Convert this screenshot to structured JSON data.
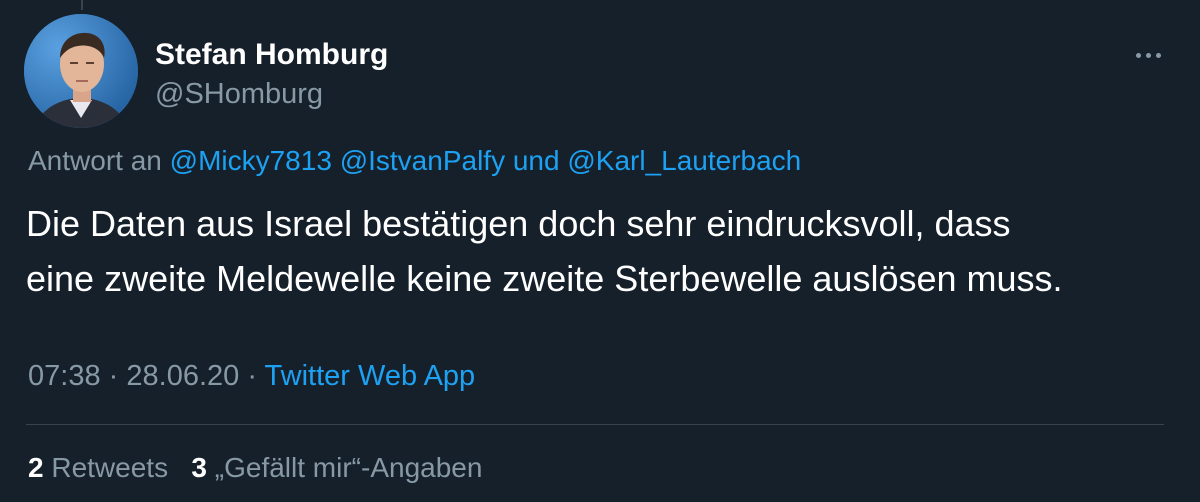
{
  "author": {
    "name": "Stefan Homburg",
    "handle": "@SHomburg"
  },
  "reply": {
    "prefix": "Antwort an",
    "mention1": "@Micky7813",
    "mention2": "@IstvanPalfy",
    "conjunction": "und",
    "mention3": "@Karl_Lauterbach"
  },
  "tweet": {
    "line1": "Die Daten aus Israel bestätigen doch sehr eindrucksvoll, dass",
    "line2": "eine zweite Meldewelle keine zweite Sterbewelle auslösen muss."
  },
  "meta": {
    "time": "07:38",
    "separator": "·",
    "date": "28.06.20",
    "source": "Twitter Web App"
  },
  "stats": {
    "retweets_count": "2",
    "retweets_label": "Retweets",
    "likes_count": "3",
    "likes_label": "„Gefällt mir“-Angaben"
  },
  "icons": {
    "more": "more-options-icon"
  },
  "colors": {
    "background": "#15202b",
    "link": "#1da1f2",
    "secondary_text": "#8899a6",
    "primary_text": "#ffffff"
  }
}
